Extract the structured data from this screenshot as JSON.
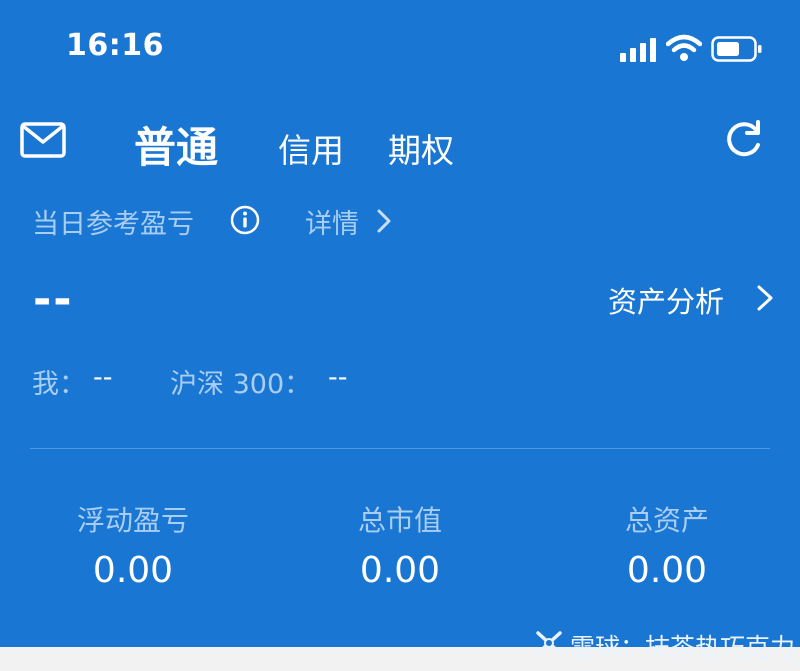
{
  "status_bar": {
    "time": "16:16"
  },
  "header": {
    "tabs": [
      {
        "label": "普通",
        "active": true
      },
      {
        "label": "信用",
        "active": false
      },
      {
        "label": "期权",
        "active": false
      }
    ]
  },
  "daily": {
    "label": "当日参考盈亏",
    "detail_label": "详情",
    "value": "--",
    "analysis_label": "资产分析"
  },
  "comparison": {
    "me_label": "我：",
    "me_value": "--",
    "index_label": "沪深 300：",
    "index_value": "--"
  },
  "stats": [
    {
      "label": "浮动盈亏",
      "value": "0.00"
    },
    {
      "label": "总市值",
      "value": "0.00"
    },
    {
      "label": "总资产",
      "value": "0.00"
    }
  ],
  "watermark": {
    "text": "雪球：抹茶热巧克力"
  },
  "colors": {
    "background": "#1976d2",
    "dim_text": "#a9cdf3",
    "bottom_strip": "#f2f2f2"
  },
  "icons": [
    "signal-icon",
    "wifi-icon",
    "battery-icon",
    "mail-icon",
    "refresh-icon",
    "info-icon",
    "chevron-right-icon",
    "xueqiu-logo-icon"
  ]
}
